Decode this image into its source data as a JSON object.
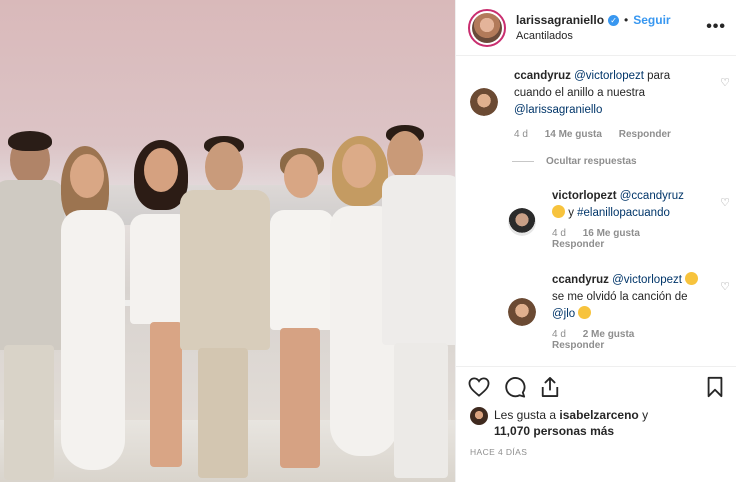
{
  "header": {
    "username": "larissagraniello",
    "verified_glyph": "✓",
    "separator": "•",
    "follow_label": "Seguir",
    "location": "Acantilados",
    "more_glyph": "•••"
  },
  "comments": [
    {
      "username": "ccandyruz",
      "mention1": "@victorlopezt",
      "text": " para cuando el anillo a nuestra ",
      "mention2": "@larissagraniello",
      "time": "4 d",
      "likes": "14 Me gusta",
      "reply": "Responder"
    }
  ],
  "hide_replies": "Ocultar respuestas",
  "replies": [
    {
      "username": "victorlopezt",
      "mention1": "@ccandyruz",
      "text": " y ",
      "hashtag": "#elanillopacuando",
      "time": "4 d",
      "likes": "16 Me gusta",
      "reply": "Responder"
    },
    {
      "username": "ccandyruz",
      "mention1": "@victorlopezt",
      "text": " se me olvidó la canción de ",
      "mention2": "@jlo",
      "time": "4 d",
      "likes": "2 Me gusta",
      "reply": "Responder"
    }
  ],
  "actions": {
    "likes_prefix": "Les gusta a ",
    "liker": "isabelzarceno",
    "likes_mid": " y",
    "others": "11,070 personas más",
    "posted": "HACE 4 DÍAS"
  },
  "colors": {
    "link": "#3897f0",
    "muted": "#8e8e8e",
    "text": "#262626"
  },
  "icons": [
    "verified-icon",
    "more-options-icon",
    "heart-icon",
    "comment-icon",
    "share-icon",
    "bookmark-icon",
    "emoji-icon"
  ]
}
